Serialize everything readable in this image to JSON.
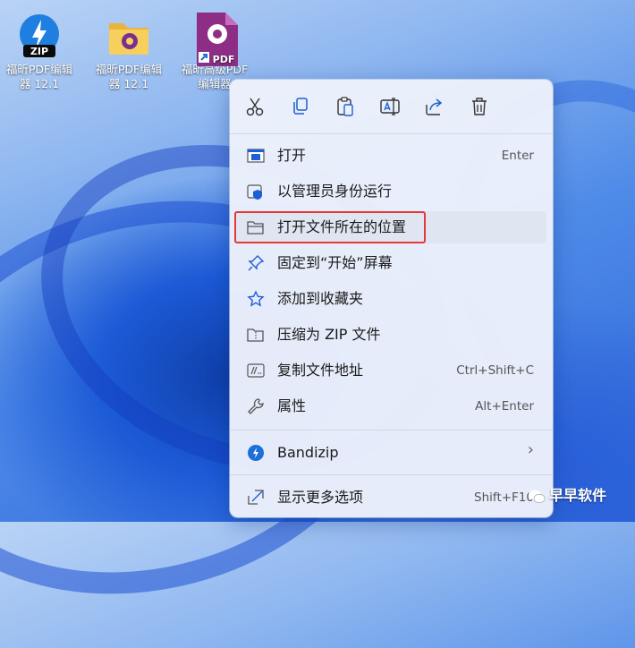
{
  "desktop": {
    "icons": [
      {
        "label_line1": "福昕PDF编辑",
        "label_line2": "器 12.1",
        "badge": "ZIP"
      },
      {
        "label_line1": "福昕PDF编辑",
        "label_line2": "器 12.1"
      },
      {
        "label_line1": "福昕高级PDF",
        "label_line2": "编辑器",
        "badge": "PDF"
      }
    ]
  },
  "context_menu": {
    "toolbar": [
      "cut-icon",
      "copy-icon",
      "paste-icon",
      "rename-icon",
      "share-icon",
      "delete-icon"
    ],
    "items": [
      {
        "label": "打开",
        "shortcut": "Enter"
      },
      {
        "label": "以管理员身份运行",
        "shortcut": ""
      },
      {
        "label": "打开文件所在的位置",
        "shortcut": ""
      },
      {
        "label": "固定到“开始”屏幕",
        "shortcut": ""
      },
      {
        "label": "添加到收藏夹",
        "shortcut": ""
      },
      {
        "label": "压缩为 ZIP 文件",
        "shortcut": ""
      },
      {
        "label": "复制文件地址",
        "shortcut": "Ctrl+Shift+C"
      },
      {
        "label": "属性",
        "shortcut": "Alt+Enter"
      },
      {
        "label": "Bandizip",
        "shortcut": "›"
      },
      {
        "label": "显示更多选项",
        "shortcut": "Shift+F10"
      }
    ]
  },
  "watermark": {
    "text": "早早软件"
  },
  "colors": {
    "highlight": "#e53935",
    "accent": "#1f5fd6"
  }
}
